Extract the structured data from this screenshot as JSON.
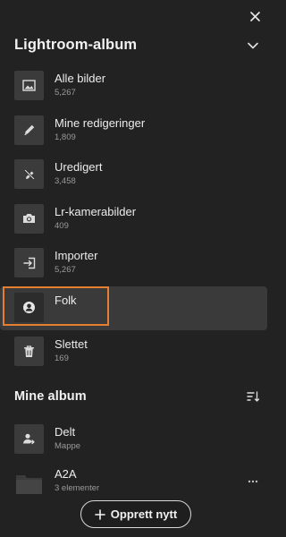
{
  "panel": {
    "close_icon": "close-icon"
  },
  "lightroom_section": {
    "title": "Lightroom-album",
    "toggle_icon": "chevron-down-icon"
  },
  "albums": [
    {
      "label": "Alle bilder",
      "count": "5,267",
      "icon": "image-icon"
    },
    {
      "label": "Mine redigeringer",
      "count": "1,809",
      "icon": "pencil-icon"
    },
    {
      "label": "Uredigert",
      "count": "3,458",
      "icon": "pen-off-icon"
    },
    {
      "label": "Lr-kamerabilder",
      "count": "409",
      "icon": "camera-icon"
    },
    {
      "label": "Importer",
      "count": "5,267",
      "icon": "import-icon"
    },
    {
      "label": "Folk",
      "count": "",
      "icon": "person-icon",
      "selected": true
    },
    {
      "label": "Slettet",
      "count": "169",
      "icon": "trash-icon"
    }
  ],
  "mine_section": {
    "title": "Mine album",
    "sort_icon": "sort-icon"
  },
  "my_albums": [
    {
      "label": "Delt",
      "subtitle": "Mappe",
      "icon": "shared-folder-icon"
    },
    {
      "label": "A2A",
      "subtitle": "3 elementer",
      "icon": "folder-icon"
    }
  ],
  "create_button": {
    "label": "Opprett nytt",
    "icon": "plus-icon"
  },
  "colors": {
    "background": "#222222",
    "selected_row": "#3a3a3a",
    "thumb": "#3b3b3b",
    "highlight": "#e67e32"
  }
}
